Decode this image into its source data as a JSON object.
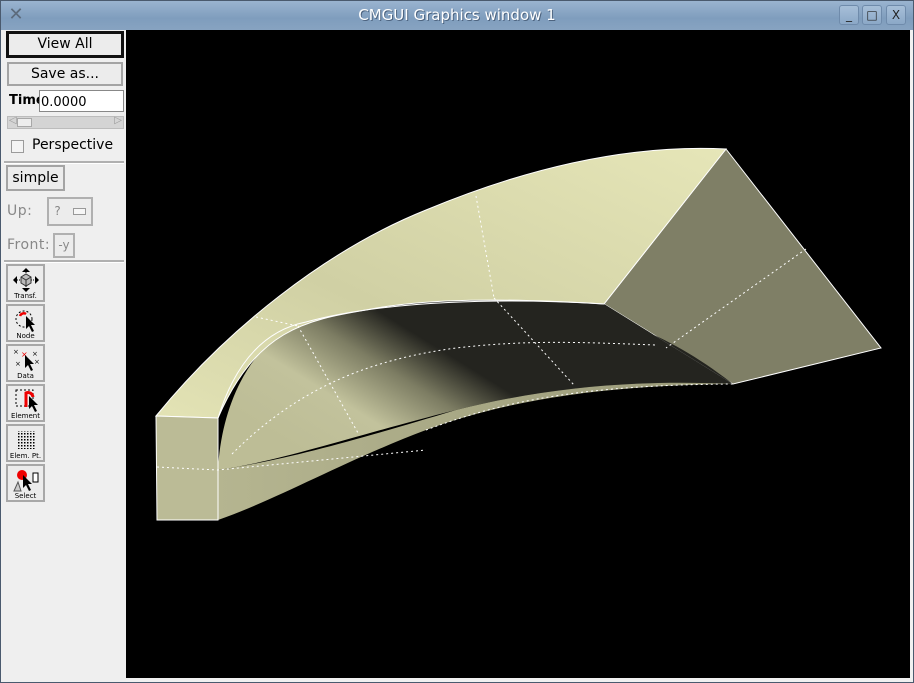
{
  "window": {
    "title": "CMGUI Graphics window 1",
    "app_icon": "x-icon",
    "controls": {
      "minimize": "_",
      "maximize": "□",
      "close": "X"
    }
  },
  "panel": {
    "view_all_label": "View All",
    "save_as_label": "Save as...",
    "time_label": "Time",
    "time_value": "0.0000",
    "time_slider_fraction": 0.0,
    "perspective_label": "Perspective",
    "perspective_checked": false,
    "layout_label": "simple",
    "up_label": "Up:",
    "up_value": "?",
    "front_label": "Front:",
    "front_value": "-y"
  },
  "tools": [
    {
      "label": "Transf.",
      "icon": "transform-icon"
    },
    {
      "label": "Node",
      "icon": "node-tool-icon"
    },
    {
      "label": "Data",
      "icon": "data-tool-icon"
    },
    {
      "label": "Element",
      "icon": "element-tool-icon"
    },
    {
      "label": "Elem. Pt.",
      "icon": "element-point-tool-icon"
    },
    {
      "label": "Select",
      "icon": "select-tool-icon"
    }
  ],
  "scene": {
    "background": "#000000",
    "object": "curved tube mesh segment",
    "surface_color": "#dfdfb0",
    "line_color": "#ffffff"
  }
}
